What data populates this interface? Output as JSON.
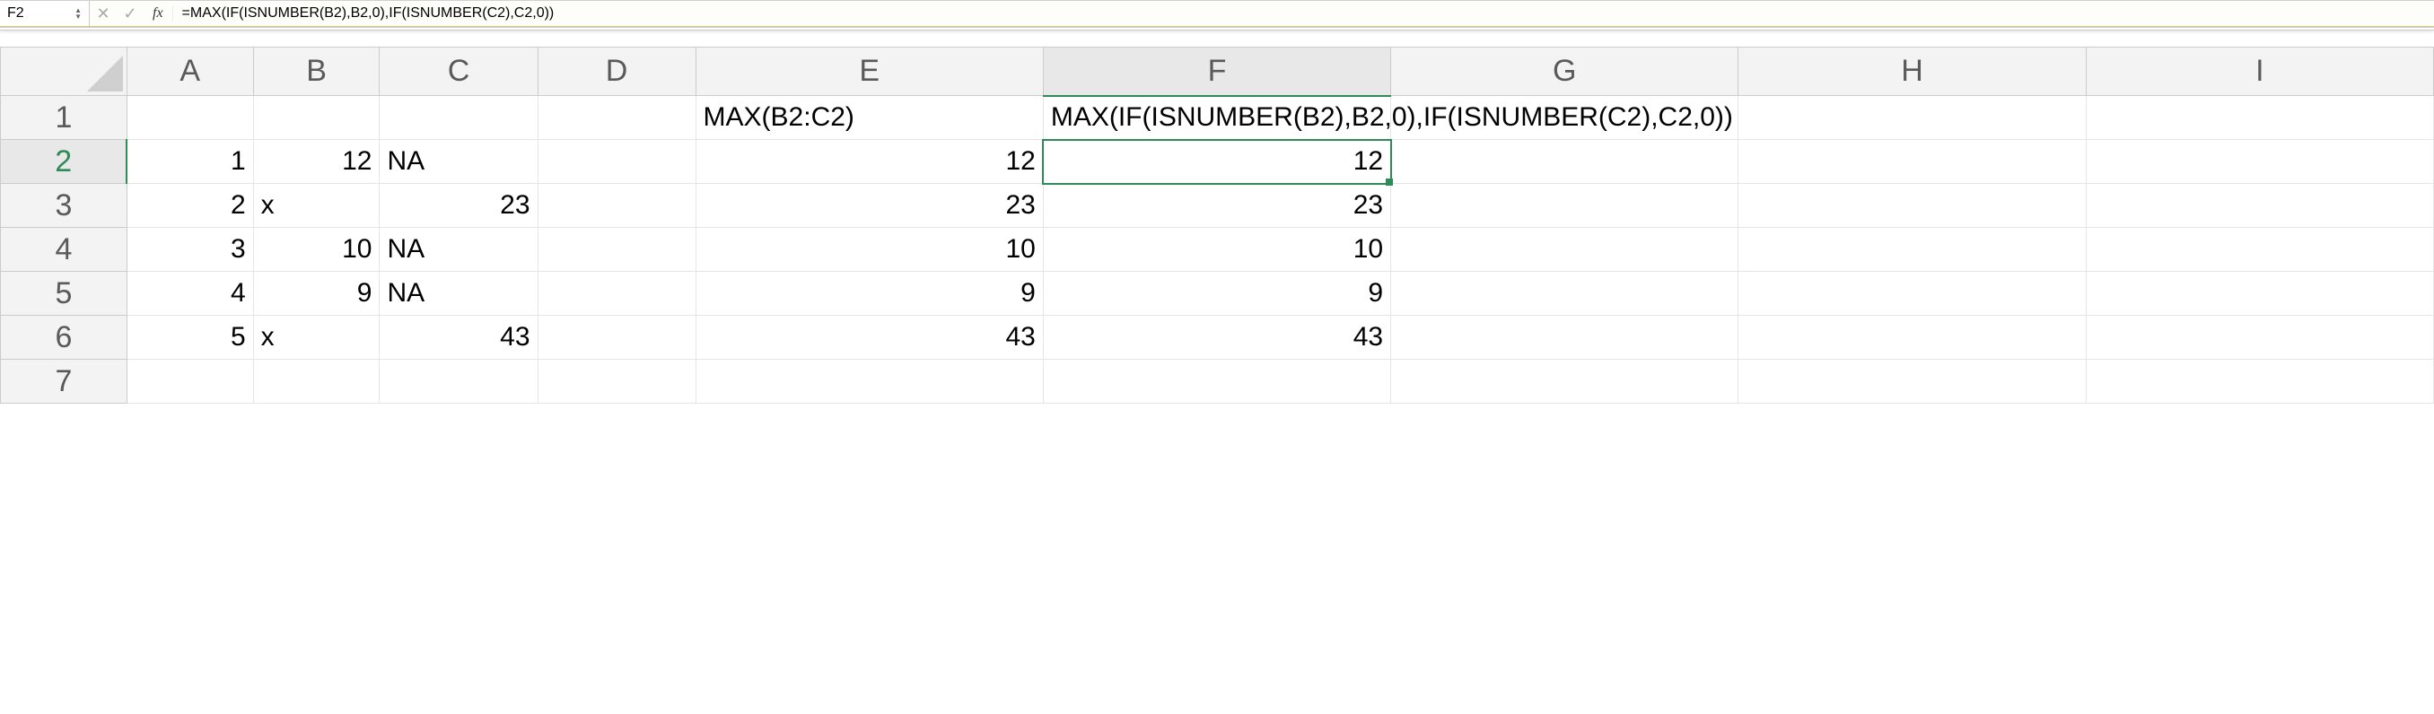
{
  "formula_bar": {
    "cell_ref": "F2",
    "cancel_glyph": "✕",
    "accept_glyph": "✓",
    "fx_label": "fx",
    "formula": "=MAX(IF(ISNUMBER(B2),B2,0),IF(ISNUMBER(C2),C2,0))"
  },
  "columns": [
    "A",
    "B",
    "C",
    "D",
    "E",
    "F",
    "G",
    "H",
    "I"
  ],
  "rows": [
    "1",
    "2",
    "3",
    "4",
    "5",
    "6",
    "7"
  ],
  "active_cell": {
    "row": "2",
    "col": "F"
  },
  "cells": {
    "E1": {
      "value": "MAX(B2:C2)",
      "type": "txt"
    },
    "F1": {
      "value": "MAX(IF(ISNUMBER(B2),B2,0),IF(ISNUMBER(C2),C2,0))",
      "type": "txt",
      "overflow": true
    },
    "A2": {
      "value": "1",
      "type": "num"
    },
    "B2": {
      "value": "12",
      "type": "num"
    },
    "C2": {
      "value": "NA",
      "type": "txt"
    },
    "E2": {
      "value": "12",
      "type": "num"
    },
    "F2": {
      "value": "12",
      "type": "num"
    },
    "A3": {
      "value": "2",
      "type": "num"
    },
    "B3": {
      "value": "x",
      "type": "txt"
    },
    "C3": {
      "value": "23",
      "type": "num"
    },
    "E3": {
      "value": "23",
      "type": "num"
    },
    "F3": {
      "value": "23",
      "type": "num"
    },
    "A4": {
      "value": "3",
      "type": "num"
    },
    "B4": {
      "value": "10",
      "type": "num"
    },
    "C4": {
      "value": "NA",
      "type": "txt"
    },
    "E4": {
      "value": "10",
      "type": "num"
    },
    "F4": {
      "value": "10",
      "type": "num"
    },
    "A5": {
      "value": "4",
      "type": "num"
    },
    "B5": {
      "value": "9",
      "type": "num"
    },
    "C5": {
      "value": "NA",
      "type": "txt"
    },
    "E5": {
      "value": "9",
      "type": "num"
    },
    "F5": {
      "value": "9",
      "type": "num"
    },
    "A6": {
      "value": "5",
      "type": "num"
    },
    "B6": {
      "value": "x",
      "type": "txt"
    },
    "C6": {
      "value": "43",
      "type": "num"
    },
    "E6": {
      "value": "43",
      "type": "num"
    },
    "F6": {
      "value": "43",
      "type": "num"
    }
  }
}
